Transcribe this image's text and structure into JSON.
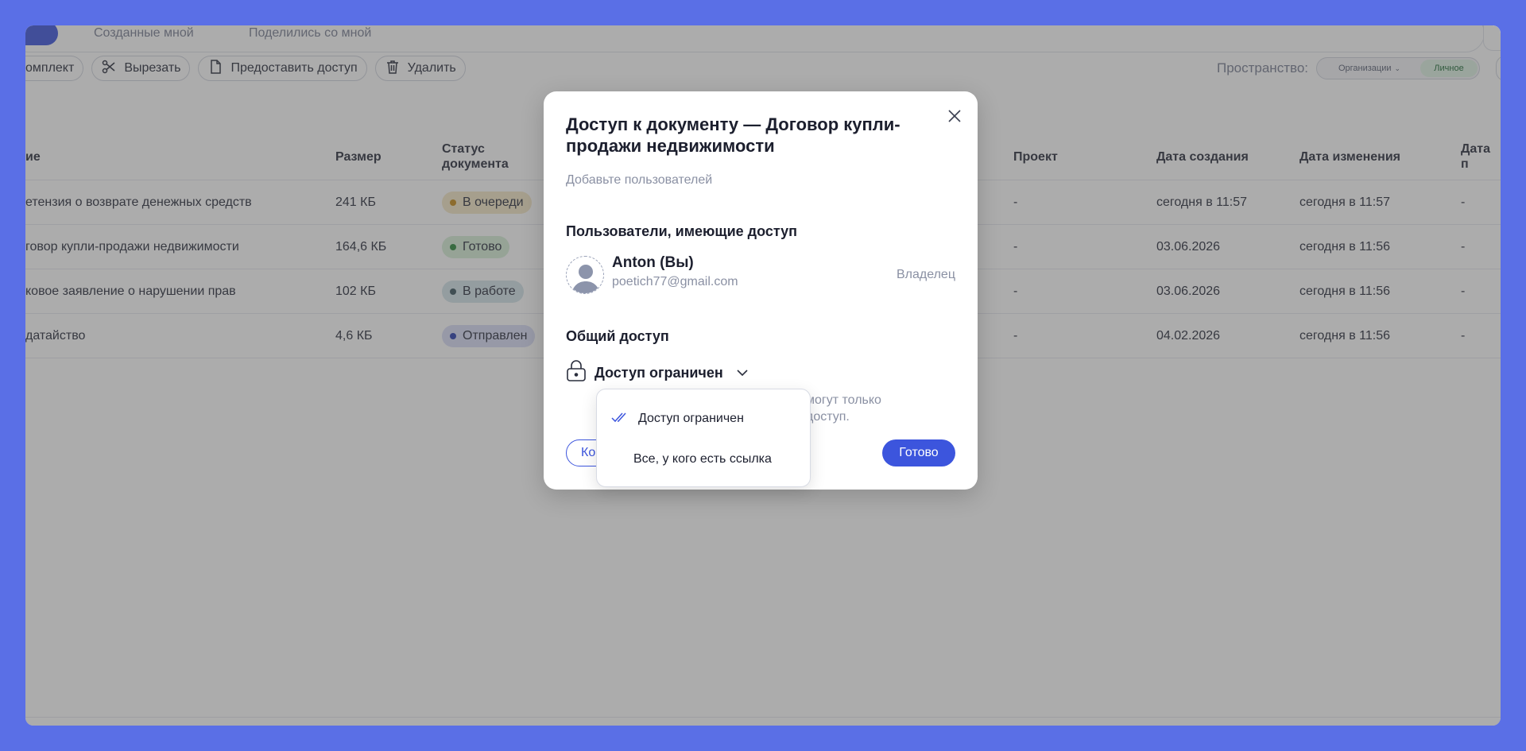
{
  "topbar": {
    "tab1": "Созданные мной",
    "tab2": "Поделились со мной"
  },
  "toolbar": {
    "items": [
      {
        "label": "омплект"
      },
      {
        "label": "Вырезать"
      },
      {
        "label": "Предоставить доступ"
      },
      {
        "label": "Удалить"
      }
    ]
  },
  "space": {
    "label": "Пространство:",
    "options": [
      "Организации",
      "Личное"
    ]
  },
  "table": {
    "headers": {
      "name": "ие",
      "size": "Размер",
      "status": "Статус документа",
      "project": "Проект",
      "created": "Дата создания",
      "modified": "Дата изменения",
      "other": "Дата п"
    },
    "rows": [
      {
        "name": "етензия о возврате денежных средств",
        "size": "241 КБ",
        "status": "В очереди",
        "project": "-",
        "created": "сегодня в 11:57",
        "modified": "сегодня в 11:57",
        "other": "-"
      },
      {
        "name": "говор купли-продажи недвижимости",
        "size": "164,6 КБ",
        "status": "Готово",
        "project": "-",
        "created": "03.06.2026",
        "modified": "сегодня в 11:56",
        "other": "-"
      },
      {
        "name": "ковое заявление о нарушении прав",
        "size": "102 КБ",
        "status": "В работе",
        "project": "-",
        "created": "03.06.2026",
        "modified": "сегодня в 11:56",
        "other": "-"
      },
      {
        "name": "датайство",
        "size": "4,6 КБ",
        "status": "Отправлен",
        "project": "-",
        "created": "04.02.2026",
        "modified": "сегодня в 11:56",
        "other": "-"
      }
    ]
  },
  "modal": {
    "title": "Доступ к документу — Договор купли-продажи недвижимости",
    "add_users": "Добавьте пользователей",
    "users_section": "Пользователи, имеющие доступ",
    "user": {
      "name": "Anton (Вы)",
      "email": "poetich77@gmail.com",
      "role": "Владелец"
    },
    "general_section": "Общий доступ",
    "access_value": "Доступ ограничен",
    "access_desc_1": "могут только",
    "access_desc_2": "доступ.",
    "copy_label": "Ко",
    "done_label": "Готово"
  },
  "dropdown": {
    "options": [
      "Доступ ограничен",
      "Все, у кого есть ссылка"
    ]
  },
  "colors": {
    "accent": "#3c55dd",
    "queue": "#f5e7c6",
    "queue_dot": "#c58a1a",
    "ready": "#d7eed8",
    "ready_dot": "#2f8a3c",
    "work": "#d4e3e9",
    "work_dot": "#3c5660",
    "sent": "#d9dcf6",
    "sent_dot": "#2a3fb0"
  }
}
